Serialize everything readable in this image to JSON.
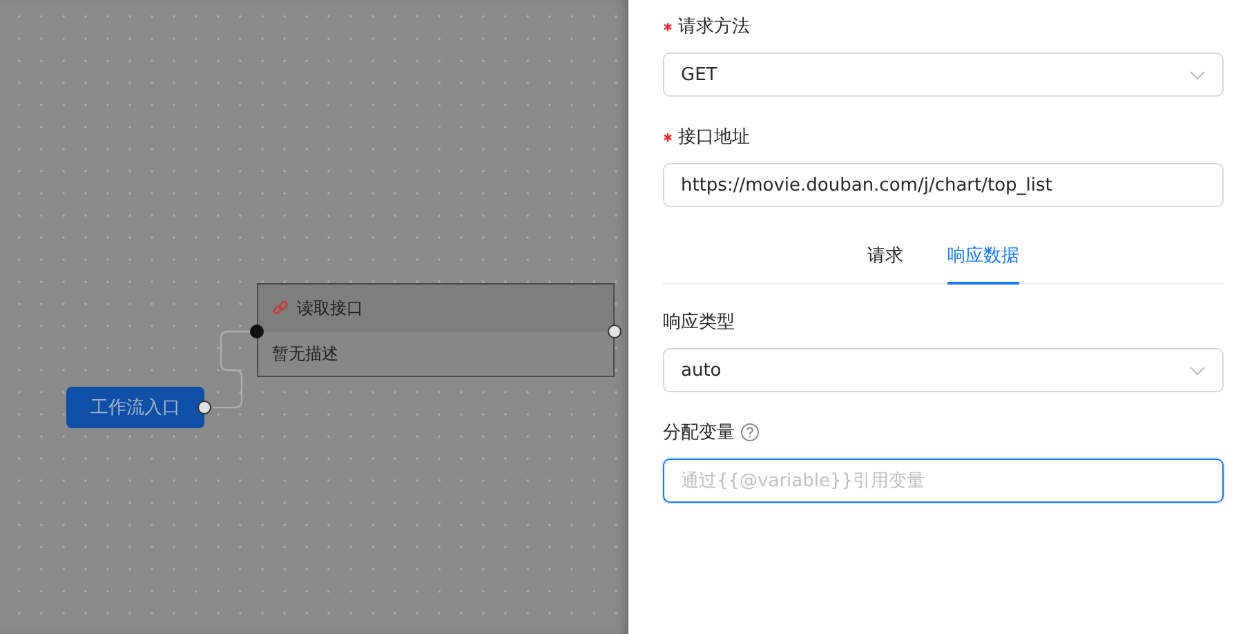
{
  "canvas": {
    "entry_node": {
      "label": "工作流入口"
    },
    "nodes": [
      {
        "title": "读取接口",
        "description": "暂无描述"
      }
    ]
  },
  "drawer": {
    "fields": [
      {
        "kind": "select",
        "label": "请求方法",
        "required": true,
        "value": "GET"
      },
      {
        "kind": "input",
        "label": "接口地址",
        "required": true,
        "value": "https://movie.douban.com/j/chart/top_list"
      }
    ],
    "tabs": [
      {
        "label": "请求",
        "selected": false
      },
      {
        "label": "响应数据",
        "selected": true
      }
    ],
    "response_fields": [
      {
        "kind": "select",
        "label": "响应类型",
        "required": false,
        "value": "auto"
      },
      {
        "kind": "input",
        "label": "分配变量",
        "required": false,
        "help": true,
        "placeholder": "通过{{@variable}}引用变量",
        "focused": true
      }
    ]
  }
}
